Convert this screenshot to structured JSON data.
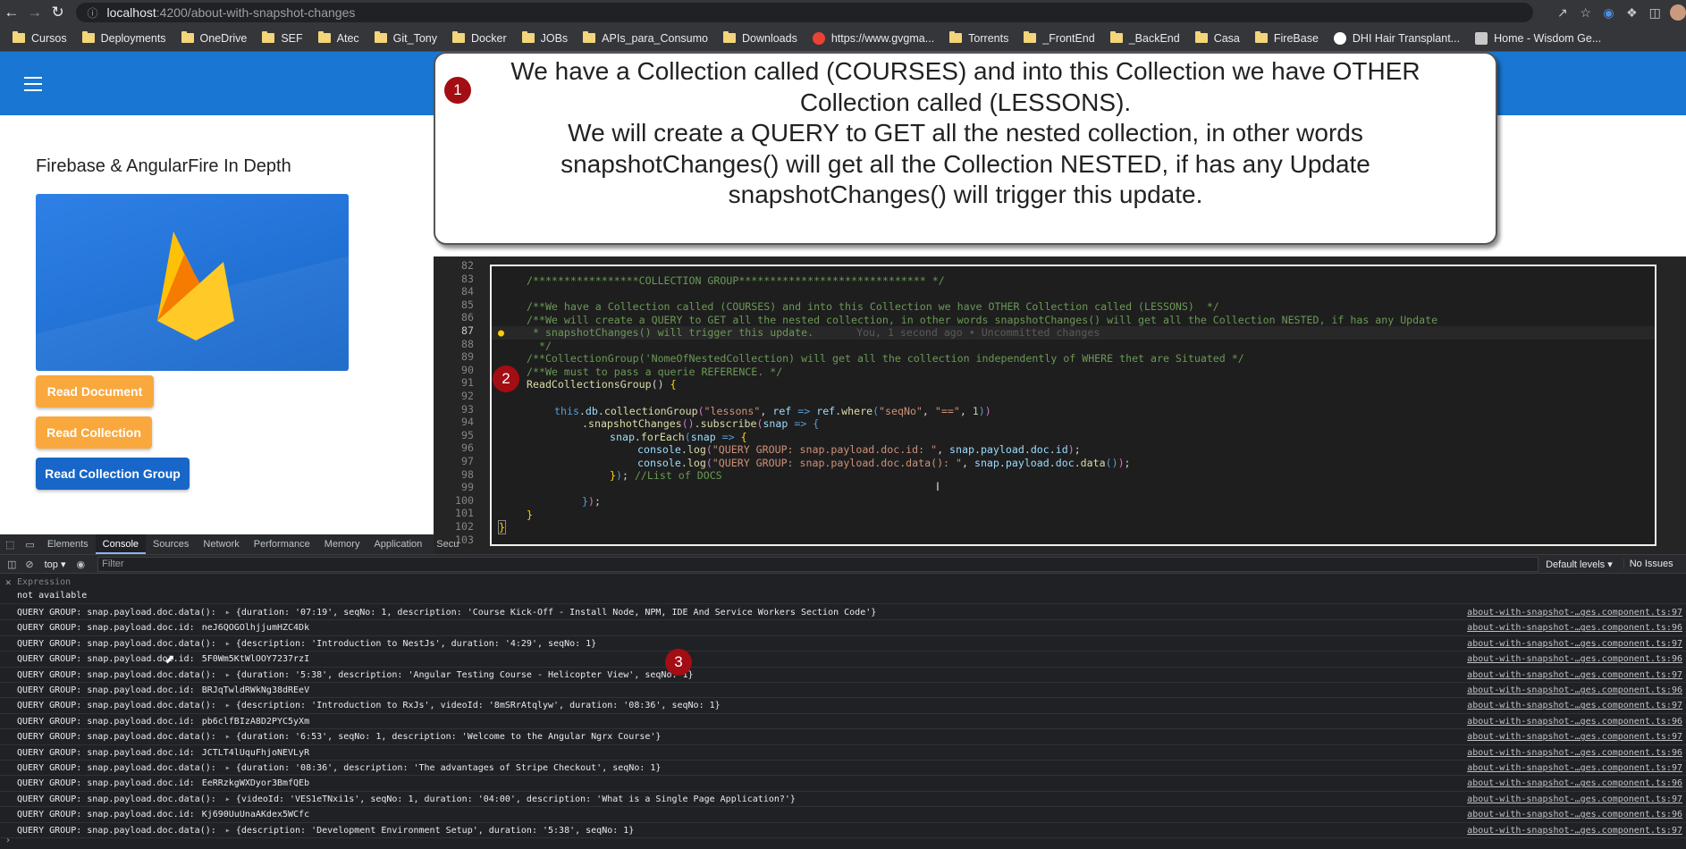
{
  "browser": {
    "url_host": "localhost",
    "url_path": ":4200/about-with-snapshot-changes",
    "bookmarks": [
      "Cursos",
      "Deployments",
      "OneDrive",
      "SEF",
      "Atec",
      "Git_Tony",
      "Docker",
      "JOBs",
      "APIs_para_Consumo",
      "Downloads",
      "https://www.gvgma...",
      "Torrents",
      "_FrontEnd",
      "_BackEnd",
      "Casa",
      "FireBase",
      "DHI Hair Transplant...",
      "Home - Wisdom Ge..."
    ]
  },
  "app": {
    "title": "Firebase & AngularFire In Depth",
    "buttons": {
      "read_document": "Read Document",
      "read_collection": "Read Collection",
      "read_collection_group": "Read Collection Group"
    },
    "colors": {
      "toolbar": "#1976d2",
      "accent": "#f9a83e",
      "primary": "#1766c8"
    }
  },
  "callout": {
    "badge": "1",
    "lines": [
      "We have a Collection called (COURSES) and into this Collection we have OTHER",
      "Collection called (LESSONS).",
      "We will create a QUERY to GET all the nested collection, in other words",
      "snapshotChanges() will get all the Collection NESTED, if has any Update",
      "snapshotChanges() will trigger this update."
    ]
  },
  "editor": {
    "badge": "2",
    "line_numbers": [
      "82",
      "83",
      "84",
      "85",
      "86",
      "87",
      "88",
      "89",
      "90",
      "91",
      "92",
      "93",
      "94",
      "95",
      "96",
      "97",
      "98",
      "99",
      "100",
      "101",
      "102",
      "103"
    ],
    "lines": {
      "l83": "/*****************COLLECTION GROUP****************************** */",
      "l85": "/**We have a Collection called (COURSES) and into this Collection we have OTHER Collection called (LESSONS)  */",
      "l86": "/**We will create a QUERY to GET all the nested collection, in other words snapshotChanges() will get all the Collection NESTED, if has any Update",
      "l87": " * snapshotChanges() will trigger this update.",
      "l87_git": "You, 1 second ago • Uncommitted changes",
      "l88": "  */",
      "l89": "/**CollectionGroup('NomeOfNestedCollection) will get all the collection independently of WHERE thet are Situated */",
      "l90": "/**We must to pass a querie REFERENCE. */",
      "l91": "ReadCollectionsGroup",
      "l93_coll": "\"lessons\"",
      "l93_field": "\"seqNo\"",
      "l93_op": "\"==\"",
      "l96_str": "\"QUERY GROUP: snap.payload.doc.id: \"",
      "l97_str": "\"QUERY GROUP: snap.payload.doc.data(): \"",
      "l98_com": "//List of DOCS"
    }
  },
  "devtools": {
    "tabs": [
      "Elements",
      "Console",
      "Sources",
      "Network",
      "Performance",
      "Memory",
      "Application",
      "Secu"
    ],
    "context": "top",
    "filter_placeholder": "Filter",
    "levels": "Default levels",
    "issues": "No Issues",
    "expression_label": "Expression",
    "expression_value": "not available",
    "badge": "3",
    "rows": [
      {
        "label": "QUERY GROUP: snap.payload.doc.data():",
        "value": "{duration: '07:19', seqNo: 1, description: 'Course Kick-Off - Install Node, NPM, IDE And Service Workers Section Code'}",
        "src": "about-with-snapshot-…ges.component.ts:97"
      },
      {
        "label": "QUERY GROUP: snap.payload.doc.id:",
        "value": "neJ6QOGOlhjjumHZC4Dk",
        "src": "about-with-snapshot-…ges.component.ts:96"
      },
      {
        "label": "QUERY GROUP: snap.payload.doc.data():",
        "value": "{description: 'Introduction to NestJs', duration: '4:29', seqNo: 1}",
        "src": "about-with-snapshot-…ges.component.ts:97"
      },
      {
        "label": "QUERY GROUP: snap.payload.doc.id:",
        "value": "5F0Wm5KtWlOOY7237rzI",
        "src": "about-with-snapshot-…ges.component.ts:96"
      },
      {
        "label": "QUERY GROUP: snap.payload.doc.data():",
        "value": "{duration: '5:38', description: 'Angular Testing Course - Helicopter View', seqNo: 1}",
        "src": "about-with-snapshot-…ges.component.ts:97"
      },
      {
        "label": "QUERY GROUP: snap.payload.doc.id:",
        "value": "BRJqTwldRWkNg38dREeV",
        "src": "about-with-snapshot-…ges.component.ts:96"
      },
      {
        "label": "QUERY GROUP: snap.payload.doc.data():",
        "value": "{description: 'Introduction to RxJs', videoId: '8mSRrAtqlyw', duration: '08:36', seqNo: 1}",
        "src": "about-with-snapshot-…ges.component.ts:97"
      },
      {
        "label": "QUERY GROUP: snap.payload.doc.id:",
        "value": "pb6clfBIzA8D2PYC5yXm",
        "src": "about-with-snapshot-…ges.component.ts:96"
      },
      {
        "label": "QUERY GROUP: snap.payload.doc.data():",
        "value": "{duration: '6:53', seqNo: 1, description: 'Welcome to the Angular Ngrx Course'}",
        "src": "about-with-snapshot-…ges.component.ts:97"
      },
      {
        "label": "QUERY GROUP: snap.payload.doc.id:",
        "value": "JCTLT4lUquFhjoNEVLyR",
        "src": "about-with-snapshot-…ges.component.ts:96"
      },
      {
        "label": "QUERY GROUP: snap.payload.doc.data():",
        "value": "{duration: '08:36', description: 'The advantages of Stripe Checkout', seqNo: 1}",
        "src": "about-with-snapshot-…ges.component.ts:97"
      },
      {
        "label": "QUERY GROUP: snap.payload.doc.id:",
        "value": "EeRRzkgWXDyor3BmfQEb",
        "src": "about-with-snapshot-…ges.component.ts:96"
      },
      {
        "label": "QUERY GROUP: snap.payload.doc.data():",
        "value": "{videoId: 'VES1eTNxi1s', seqNo: 1, duration: '04:00', description: 'What is a Single Page Application?'}",
        "src": "about-with-snapshot-…ges.component.ts:97"
      },
      {
        "label": "QUERY GROUP: snap.payload.doc.id:",
        "value": "Kj690UuUnaAKdex5WCfc",
        "src": "about-with-snapshot-…ges.component.ts:96"
      },
      {
        "label": "QUERY GROUP: snap.payload.doc.data():",
        "value": "{description: 'Development Environment Setup', duration: '5:38', seqNo: 1}",
        "src": "about-with-snapshot-…ges.component.ts:97"
      }
    ]
  }
}
